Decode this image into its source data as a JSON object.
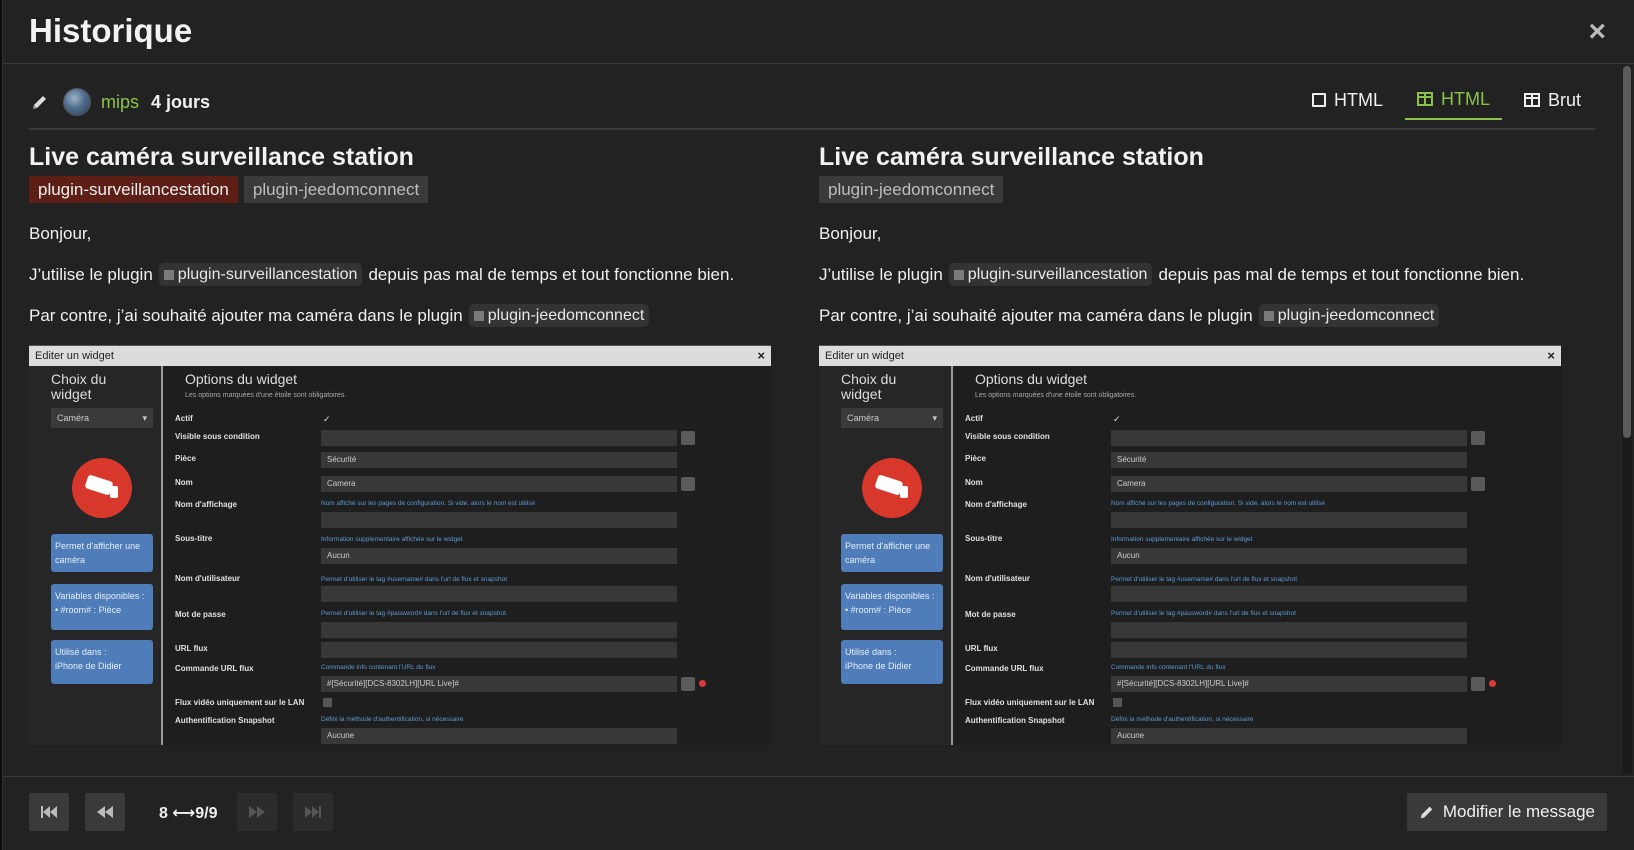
{
  "modal": {
    "title": "Historique",
    "close_symbol": "×"
  },
  "meta": {
    "username": "mips",
    "age": "4 jours"
  },
  "view_tabs": [
    {
      "label": "HTML",
      "icon": "square-icon",
      "active": false
    },
    {
      "label": "HTML",
      "icon": "columns-icon",
      "active": true
    },
    {
      "label": "Brut",
      "icon": "columns-icon",
      "active": false
    }
  ],
  "left": {
    "title": "Live caméra surveillance station",
    "tags": [
      "plugin-surveillancestation",
      "plugin-jeedomconnect"
    ],
    "p1": "Bonjour,",
    "p2_before": "J’utilise le plugin",
    "p2_tag": "plugin-surveillancestation",
    "p2_after": "depuis pas mal de temps et tout fonctionne bien.",
    "p3_before": "Par contre, j’ai souhaité ajouter ma caméra dans le plugin",
    "p3_tag": "plugin-jeedomconnect"
  },
  "right": {
    "title": "Live caméra surveillance station",
    "tags": [
      "plugin-jeedomconnect"
    ],
    "p1": "Bonjour,",
    "p2_before": "J’utilise le plugin",
    "p2_tag": "plugin-surveillancestation",
    "p2_after": "depuis pas mal de temps et tout fonctionne bien.",
    "p3_before": "Par contre, j’ai souhaité ajouter ma caméra dans le plugin",
    "p3_tag": "plugin-jeedomconnect"
  },
  "screenshot": {
    "window_title": "Editer un widget",
    "side_title": "Choix du widget",
    "widget_type": "Caméra",
    "box1": "Permet d'afficher une caméra",
    "box2_title": "Variables disponibles :",
    "box2_item": "#room# : Pièce",
    "box3_title": "Utilisé dans :",
    "box3_item": "iPhone de Didier",
    "options_title": "Options du widget",
    "options_sub": "Les options marquées d'une étoile sont obligatoires.",
    "labels": {
      "actif": "Actif",
      "visible": "Visible sous condition",
      "piece": "Pièce",
      "nom": "Nom",
      "nom_affichage": "Nom d'affichage",
      "sous_titre": "Sous-titre",
      "nom_utilisateur": "Nom d'utilisateur",
      "mot_de_passe": "Mot de passe",
      "url_flux": "URL flux",
      "commande_url": "Commande URL flux",
      "flux_lan": "Flux vidéo uniquement sur le LAN",
      "auth": "Authentification Snapshot"
    },
    "values": {
      "piece": "Sécurité",
      "nom": "Camera",
      "sous_titre": "Aucun",
      "commande_url": "#[Sécurité][DCS-8302LH][URL Live]#",
      "auth": "Aucune"
    },
    "help": {
      "nom_affichage": "Nom affiché sur les pages de configuration. Si vide, alors le nom est utilisé",
      "sous_titre": "Information supplementaire affichée sur le widget",
      "nom_utilisateur": "Permet d'utiliser le tag #username# dans l'url de flux et snapshot",
      "mot_de_passe": "Permet d'utiliser le tag #password# dans l'url de flux et snapshot",
      "commande_url": "Commande info contenant l'URL du flux",
      "auth": "Défini la méthode d'authentification, si nécessaire"
    }
  },
  "footer": {
    "revision": "8 ⟷9/9",
    "edit_label": "Modifier le message"
  }
}
